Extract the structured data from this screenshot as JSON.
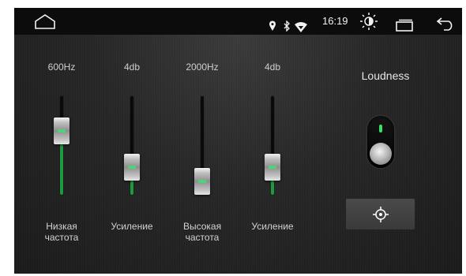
{
  "status_bar": {
    "time": "16:19",
    "icons": [
      "home-icon",
      "location-icon",
      "bluetooth-icon",
      "wifi-icon",
      "brightness-icon",
      "recents-icon",
      "back-icon"
    ]
  },
  "equalizer": {
    "bands": [
      {
        "value": "600Hz",
        "label": "Низкая\nчастота",
        "level": 0.7
      },
      {
        "value": "4db",
        "label": "Усиление",
        "level": 0.2
      },
      {
        "value": "2000Hz",
        "label": "Высокая\nчастота",
        "level": 0.0
      },
      {
        "value": "4db",
        "label": "Усиление",
        "level": 0.2
      }
    ]
  },
  "loudness": {
    "label": "Loudness",
    "enabled": true
  },
  "colors": {
    "accent_green": "#1e9a3e",
    "led_green": "#3ddc6a",
    "statusbar_bg": "#0c0c0c"
  }
}
